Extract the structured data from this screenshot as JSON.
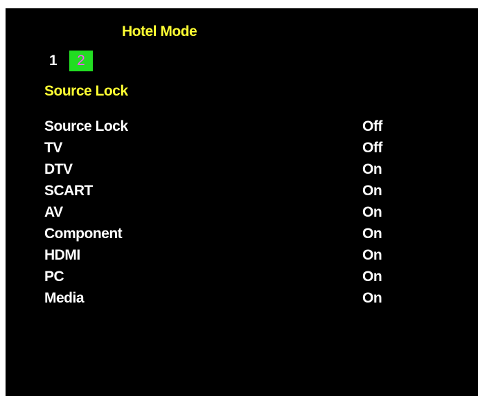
{
  "colors": {
    "background": "#000000",
    "heading": "#ffff33",
    "text": "#ffffff",
    "active_page_bg": "#22dd22",
    "active_page_text": "#ff55ff"
  },
  "menu": {
    "title": "Hotel Mode",
    "pages": [
      "1",
      "2"
    ],
    "active_page": "2",
    "section_title": "Source Lock",
    "items": [
      {
        "label": "Source Lock",
        "value": "Off"
      },
      {
        "label": "TV",
        "value": "Off"
      },
      {
        "label": "DTV",
        "value": "On"
      },
      {
        "label": "SCART",
        "value": "On"
      },
      {
        "label": "AV",
        "value": "On"
      },
      {
        "label": "Component",
        "value": "On"
      },
      {
        "label": "HDMI",
        "value": "On"
      },
      {
        "label": "PC",
        "value": "On"
      },
      {
        "label": "Media",
        "value": "On"
      }
    ]
  }
}
